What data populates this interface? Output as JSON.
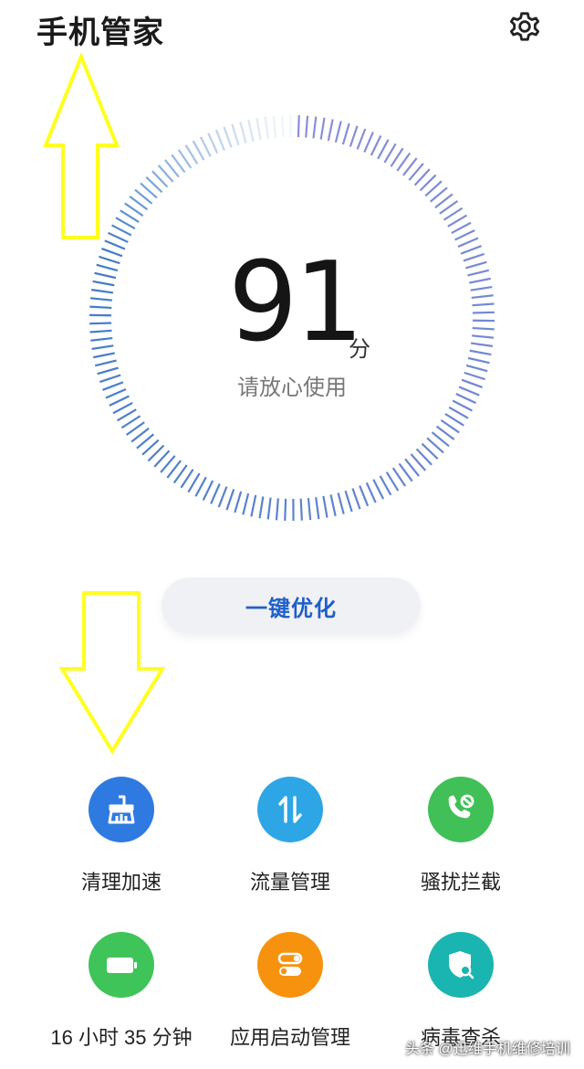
{
  "header": {
    "title": "手机管家",
    "settings_icon": "gear-icon"
  },
  "score": {
    "value": "91",
    "unit": "分",
    "status": "请放心使用",
    "ring_colors": {
      "start": "#8a8fd8",
      "end": "#3e7ac6"
    }
  },
  "optimize_button": {
    "label": "一键优化",
    "color": "#1f5fc9"
  },
  "tools": [
    {
      "label": "清理加速",
      "icon": "broom-icon",
      "color": "#2f7ae0"
    },
    {
      "label": "流量管理",
      "icon": "data-transfer-icon",
      "color": "#2ea6e6"
    },
    {
      "label": "骚扰拦截",
      "icon": "phone-block-icon",
      "color": "#40c057"
    },
    {
      "label": "16 小时 35 分钟",
      "icon": "battery-icon",
      "color": "#3fc45a"
    },
    {
      "label": "应用启动管理",
      "icon": "toggle-switch-icon",
      "color": "#f7920e"
    },
    {
      "label": "病毒查杀",
      "icon": "shield-scan-icon",
      "color": "#1ab5b0"
    }
  ],
  "annotations": {
    "arrow_color": "#ffff1e"
  },
  "watermark": "头条 @迅维手机维修培训"
}
